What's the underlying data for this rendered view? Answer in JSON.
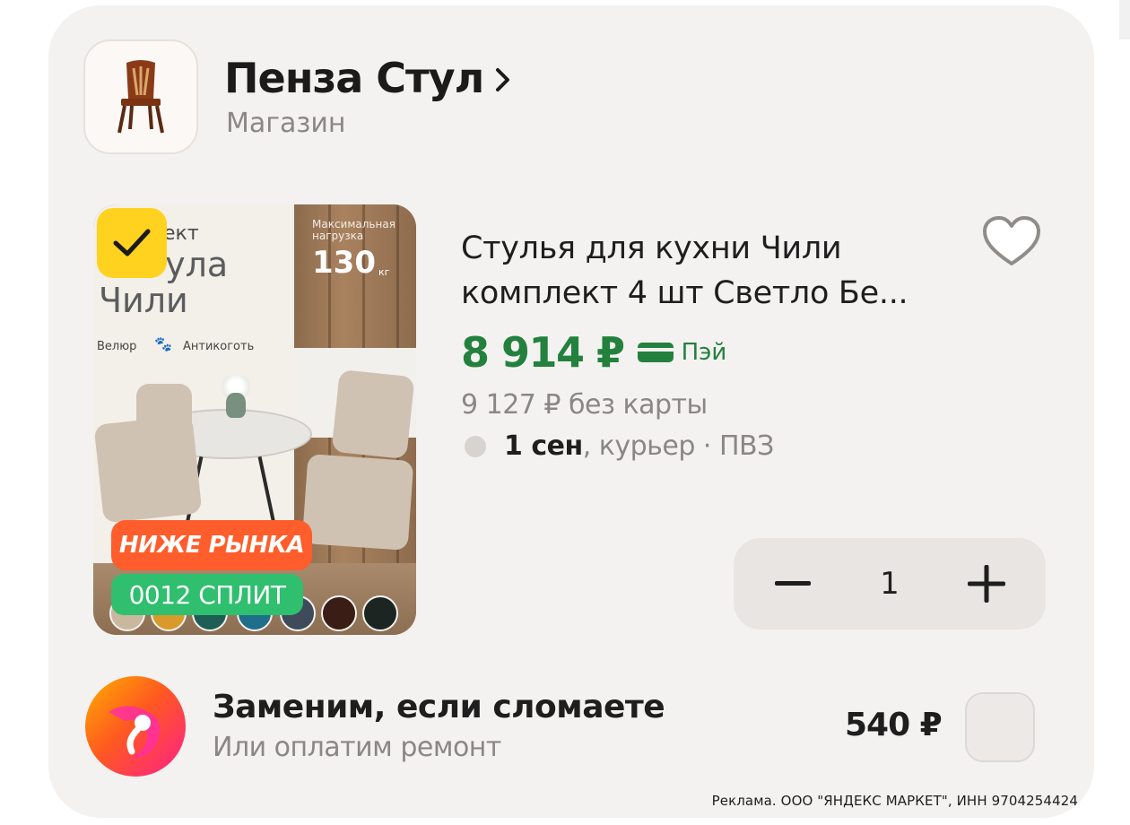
{
  "shop": {
    "name": "Пенза Стул",
    "subtitle": "Магазин",
    "logo_icon": "chair-icon"
  },
  "product": {
    "image_texts": {
      "kit": "ект",
      "stula": "тула",
      "chili": "Чили",
      "velour": "Велюр",
      "anticlaw": "Антикоготь",
      "max_load": "Максимальная нагрузка",
      "load_value": "130",
      "load_unit": "кг"
    },
    "badges": {
      "market": "НИЖЕ РЫНКА",
      "split": "0012 СПЛИТ"
    },
    "swatch_colors": [
      "#c9b79e",
      "#d89a2b",
      "#1f5e54",
      "#1f6e8a",
      "#3f4a5a",
      "#3a1d14",
      "#1d2522"
    ],
    "title": "Стулья для кухни Чили комплект 4 шт Светло Бе...",
    "price": "8 914 ₽",
    "pay_label": "Пэй",
    "old_price": "9 127 ₽ без карты",
    "delivery_date": "1 сен",
    "delivery_rest": ", курьер · ПВЗ",
    "quantity": "1"
  },
  "insurance": {
    "title": "Заменим, если сломаете",
    "subtitle": "Или оплатим ремонт",
    "price": "540 ₽"
  },
  "ad_notice": "Реклама. ООО \"ЯНДЕКС МАРКЕТ\", ИНН 9704254424",
  "colors": {
    "price_green": "#23813d",
    "check_yellow": "#ffd21f",
    "market_badge": "#ff5d2b",
    "split_badge": "#2fbf6e"
  }
}
